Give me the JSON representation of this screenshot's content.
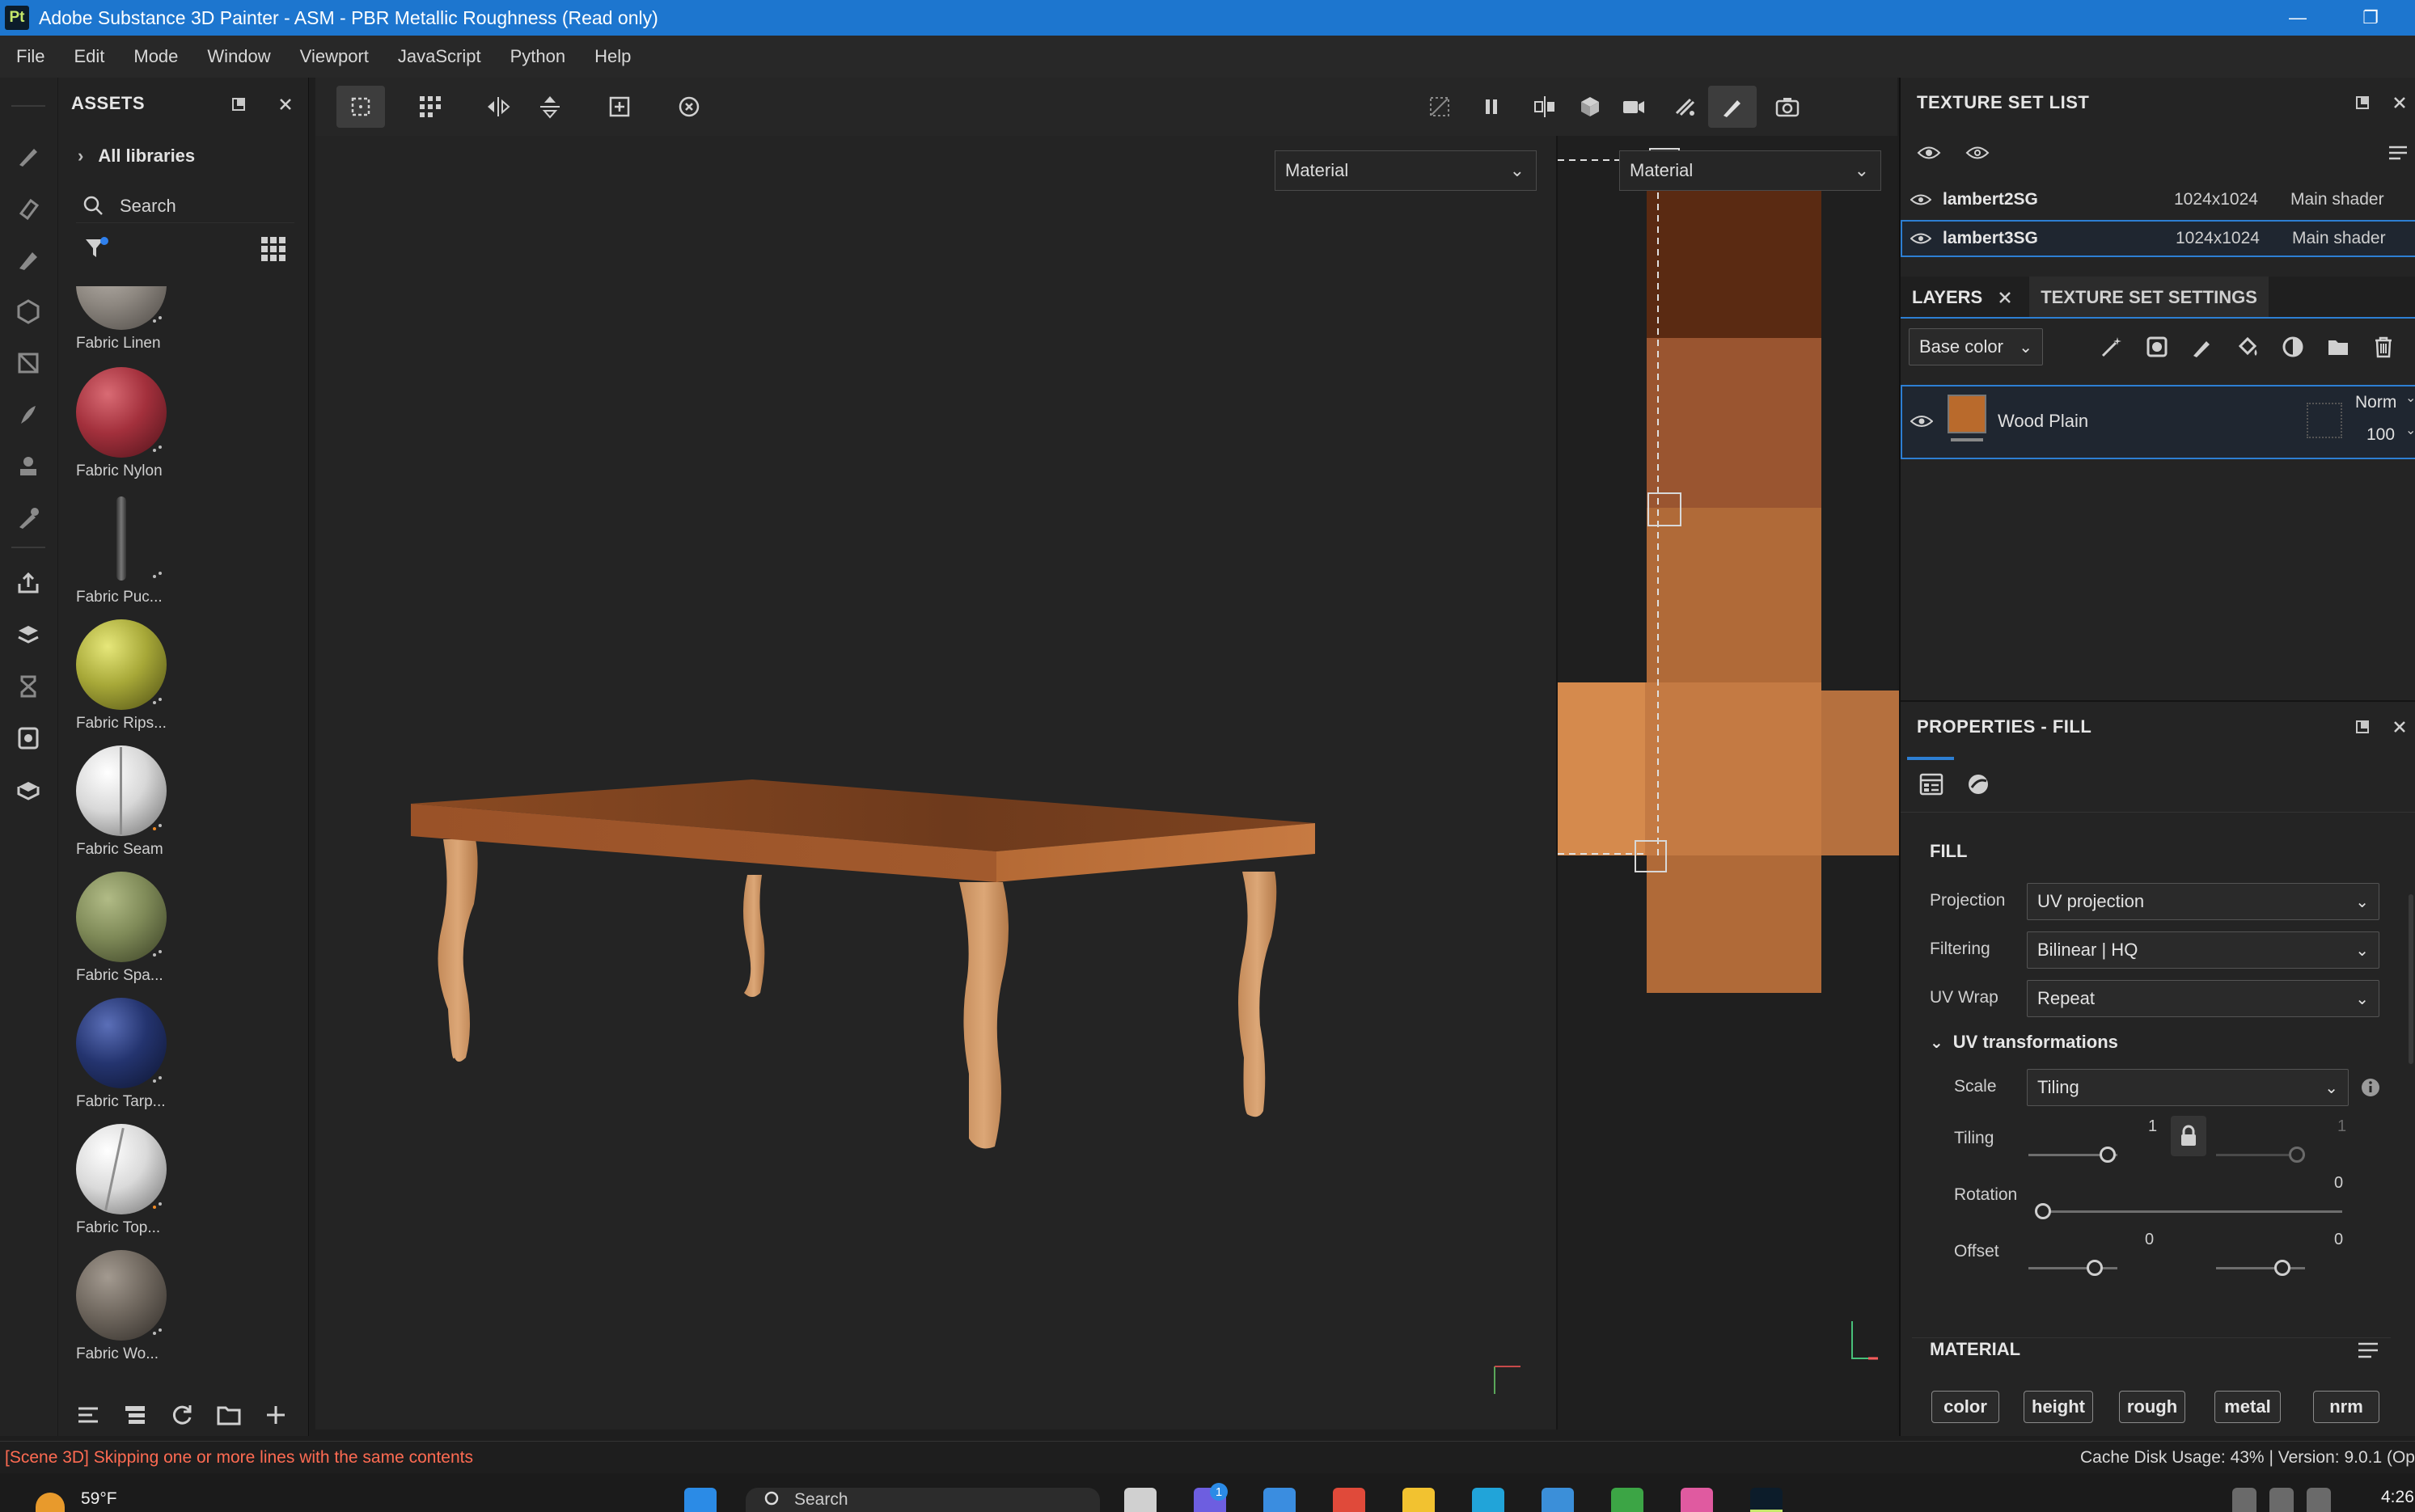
{
  "app": {
    "icon_text": "Pt",
    "title": "Adobe Substance 3D Painter - ASM - PBR Metallic Roughness (Read only)",
    "minimize_glyph": "—",
    "maximize_glyph": "❐"
  },
  "menu": [
    "File",
    "Edit",
    "Mode",
    "Window",
    "Viewport",
    "JavaScript",
    "Python",
    "Help"
  ],
  "assets": {
    "title": "ASSETS",
    "all_libraries": "All libraries",
    "search_placeholder": "Search",
    "items": [
      {
        "label": "Fabric Linen",
        "color": "#8d8780"
      },
      {
        "label": "Fabric Nylon",
        "color": "#a3303c"
      },
      {
        "label": "Fabric Puc...",
        "color": "#555555"
      },
      {
        "label": "Fabric Rips...",
        "color": "#a7a838"
      },
      {
        "label": "Fabric Seam",
        "color": "#d8d8d8"
      },
      {
        "label": "Fabric Spa...",
        "color": "#7f8a58"
      },
      {
        "label": "Fabric Tarp...",
        "color": "#24346f"
      },
      {
        "label": "Fabric Top...",
        "color": "#dadada"
      },
      {
        "label": "Fabric Wo...",
        "color": "#6f675e"
      }
    ]
  },
  "viewport": {
    "material_left": "Material",
    "material_right": "Material"
  },
  "texture_set_list": {
    "title": "TEXTURE SET LIST",
    "rows": [
      {
        "name": "lambert2SG",
        "resolution": "1024x1024",
        "shader": "Main shader"
      },
      {
        "name": "lambert3SG",
        "resolution": "1024x1024",
        "shader": "Main shader"
      }
    ]
  },
  "layers": {
    "tab_layers": "LAYERS",
    "tab_settings": "TEXTURE SET SETTINGS",
    "channel": "Base color",
    "items": [
      {
        "name": "Wood Plain",
        "blend": "Norm",
        "opacity": "100",
        "color": "#b96a2c"
      }
    ]
  },
  "properties": {
    "title": "PROPERTIES - FILL",
    "section_fill": "FILL",
    "projection_label": "Projection",
    "projection_value": "UV projection",
    "filtering_label": "Filtering",
    "filtering_value": "Bilinear | HQ",
    "uvwrap_label": "UV Wrap",
    "uvwrap_value": "Repeat",
    "uv_transformations": "UV transformations",
    "scale_label": "Scale",
    "scale_value": "Tiling",
    "tiling_label": "Tiling",
    "tiling_value_1": "1",
    "tiling_value_2": "1",
    "rotation_label": "Rotation",
    "rotation_value": "0",
    "offset_label": "Offset",
    "offset_value_1": "0",
    "offset_value_2": "0",
    "section_material": "MATERIAL",
    "channels": [
      "color",
      "height",
      "rough",
      "metal",
      "nrm"
    ]
  },
  "status": {
    "message": "[Scene 3D] Skipping one or more lines with the same contents",
    "cache": "Cache Disk Usage:   43% | Version: 9.0.1 (Op"
  },
  "taskbar": {
    "weather": "59°F",
    "search": "Search",
    "time": "4:26",
    "badge": "1"
  }
}
